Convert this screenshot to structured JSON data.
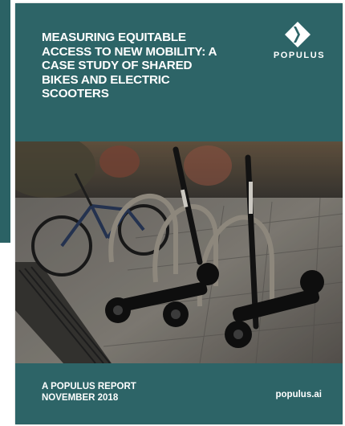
{
  "cover": {
    "title": "MEASURING EQUITABLE ACCESS TO NEW MOBILITY: A CASE STUDY OF SHARED BIKES AND ELECTRIC SCOOTERS",
    "brand_name": "POPULUS",
    "brand_icon": "populus-logo-icon",
    "report_label": "A POPULUS REPORT",
    "report_date": "NOVEMBER 2018",
    "website": "populus.ai"
  },
  "photo": {
    "subject": "bikes-and-scooters-at-racks-photo"
  },
  "colors": {
    "cover_teal": "#2d6467",
    "text": "#ffffff"
  }
}
